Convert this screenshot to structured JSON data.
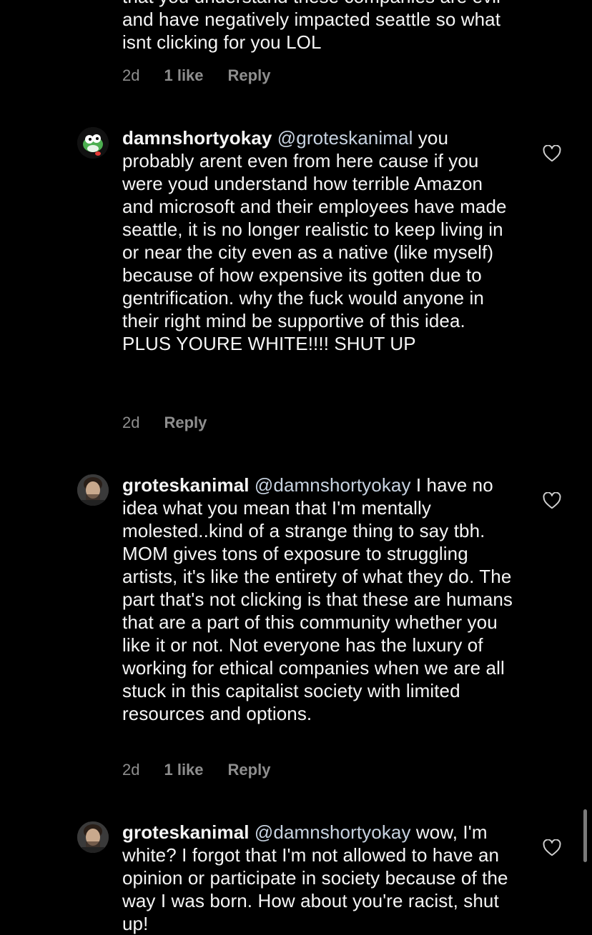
{
  "comments": [
    {
      "username": "",
      "mention": "",
      "text": "that you understand these companies are evil and have negatively impacted seattle so what isnt clicking for you LOL",
      "time": "2d",
      "likes": "1 like",
      "reply": "Reply"
    },
    {
      "username": "damnshortyokay",
      "mention": "@groteskanimal",
      "text": "you probably arent even from here cause if you were youd understand how terrible Amazon and microsoft and their employees have made seattle, it is no longer realistic to keep living in or near the city even as a native (like myself) because of how expensive its gotten due to gentrification. why the fuck would anyone in their right mind be supportive of this idea. PLUS YOURE WHITE!!!! SHUT UP",
      "time": "2d",
      "likes": "",
      "reply": "Reply"
    },
    {
      "username": "groteskanimal",
      "mention": "@damnshortyokay",
      "text": "I have no idea what you mean that I'm mentally molested..kind of a strange thing to say tbh. MOM gives tons of exposure to struggling artists, it's like the entirety of what they do. The part that's not clicking is that these are humans that are a part of this community whether you like it or not. Not everyone has the luxury of working for ethical companies when we are all stuck in this capitalist society with limited resources and options.",
      "time": "2d",
      "likes": "1 like",
      "reply": "Reply"
    },
    {
      "username": "groteskanimal",
      "mention": "@damnshortyokay",
      "text": "wow, I'm white? I forgot that I'm not allowed to have an opinion or participate in society because of the way I was born. How about you're racist, shut up!",
      "time": "",
      "likes": "",
      "reply": ""
    }
  ],
  "icons": {
    "like": "heart-outline-icon",
    "avatar_green": "yoshi-avatar",
    "avatar_person": "person-avatar"
  },
  "colors": {
    "background": "#000000",
    "text": "#f5f5f5",
    "meta": "#8e8e8e",
    "mention": "#c7d2e0"
  }
}
